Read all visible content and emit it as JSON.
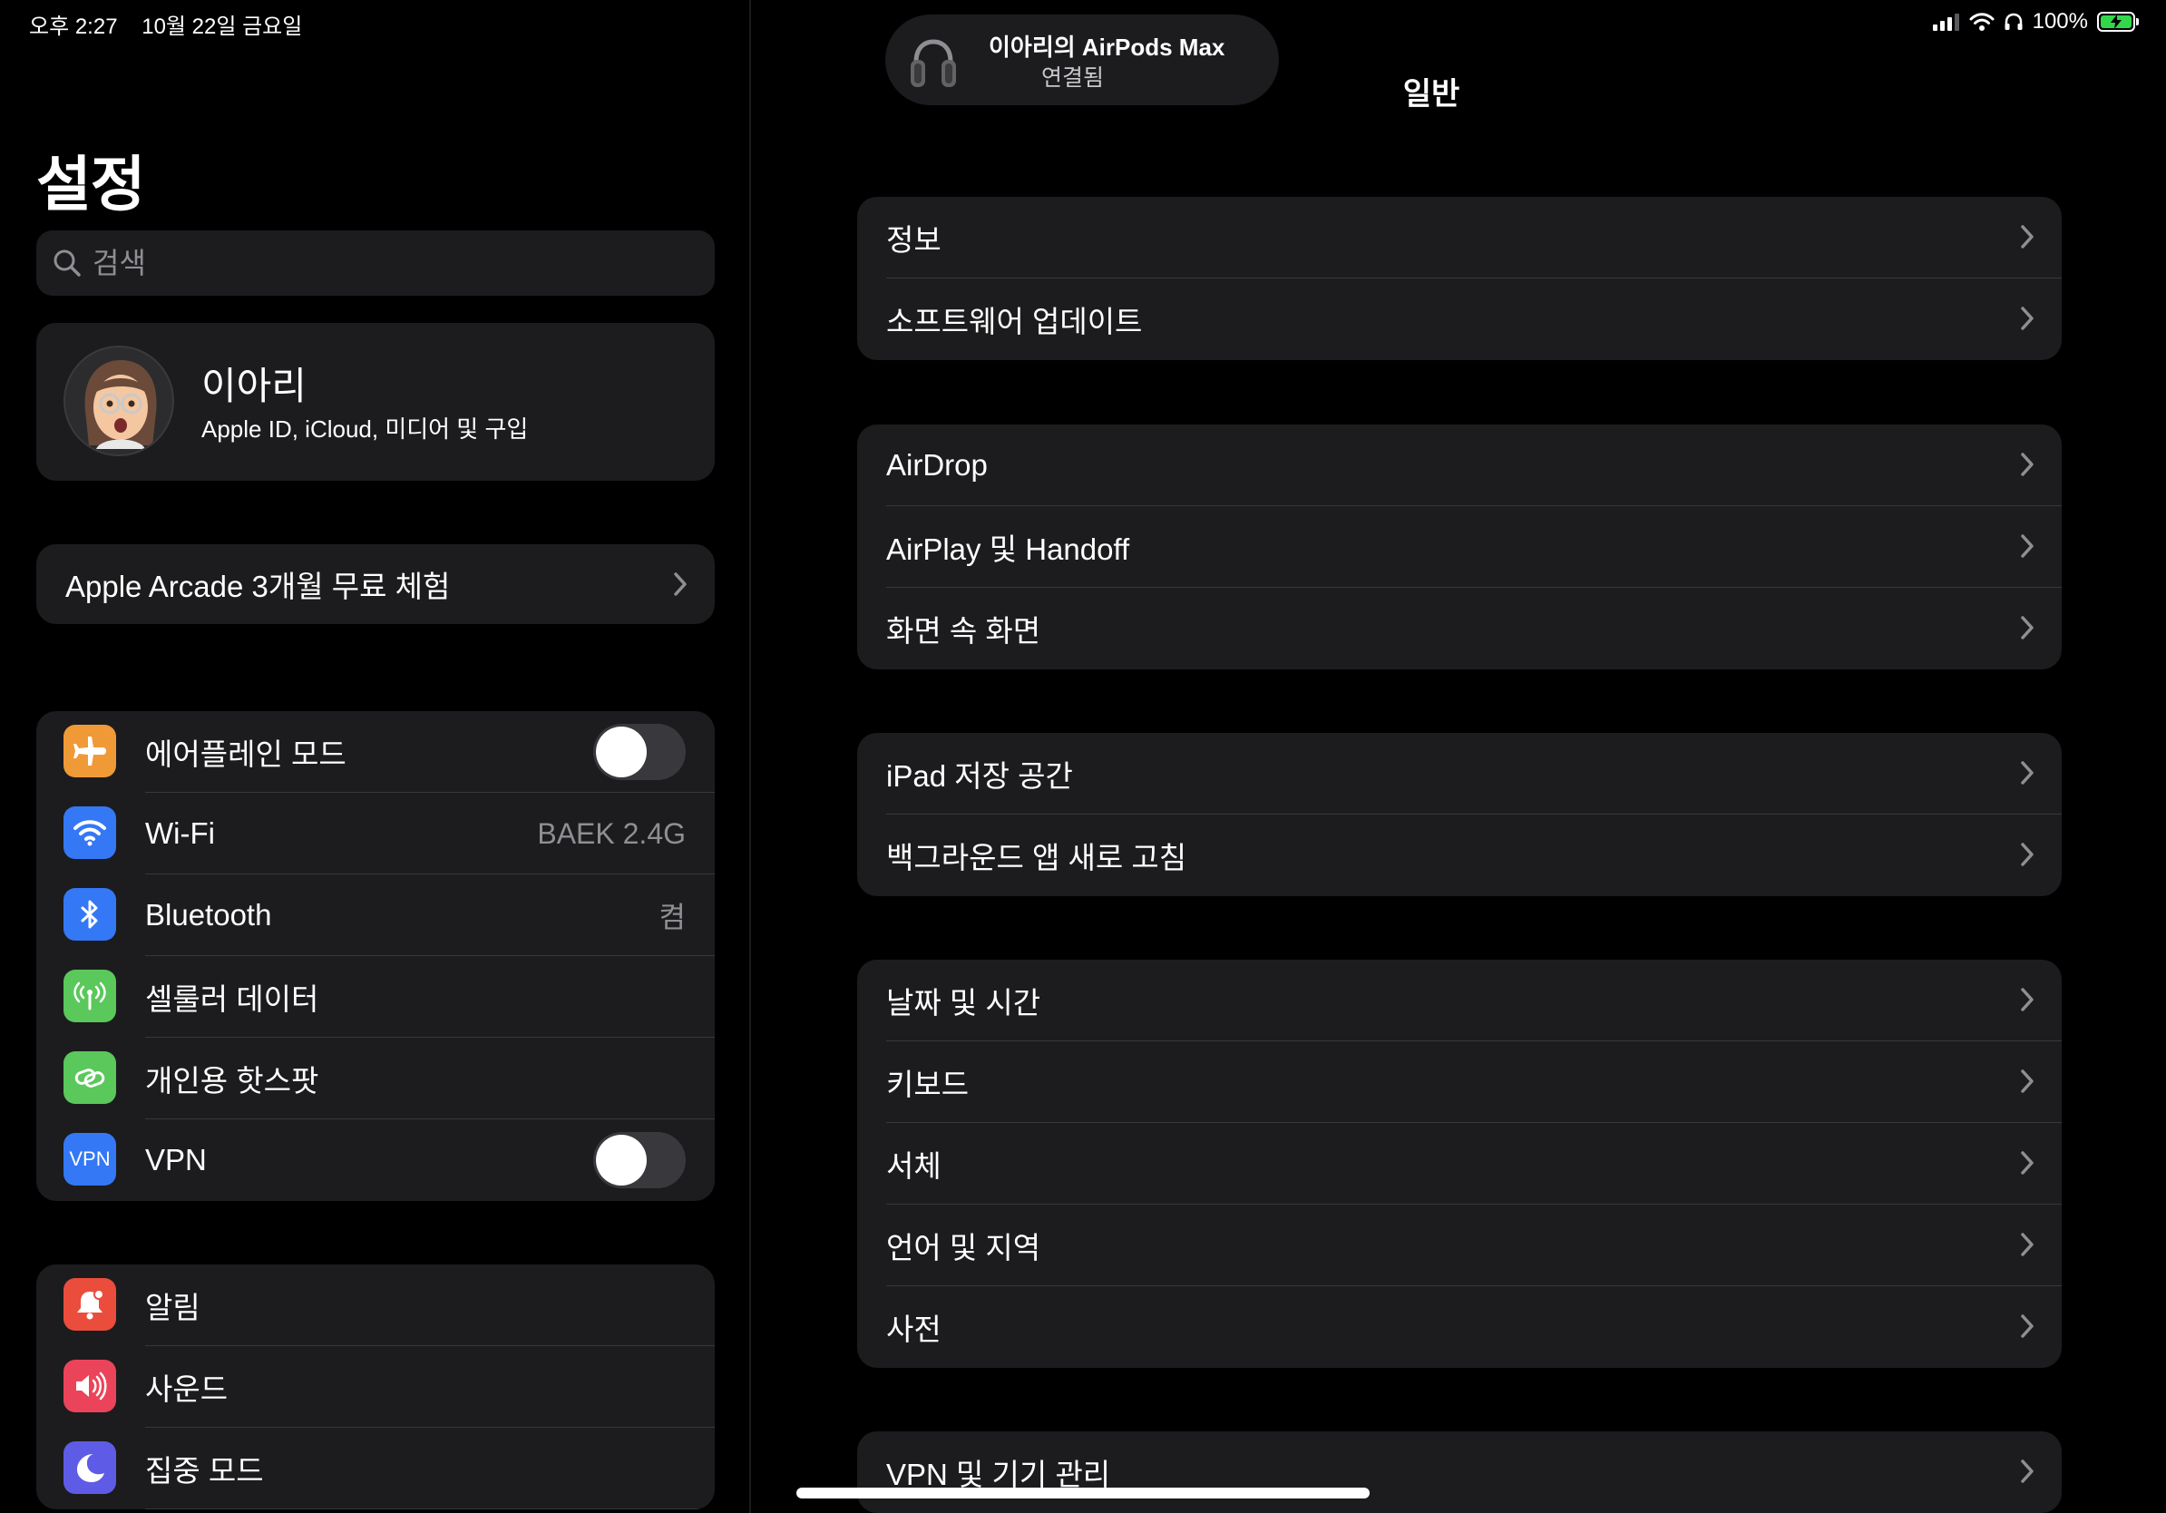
{
  "status_bar": {
    "time": "오후 2:27",
    "date": "10월 22일 금요일",
    "battery": "100%",
    "battery_color": "#32d74b"
  },
  "sidebar": {
    "title": "설정",
    "search_placeholder": "검색",
    "profile": {
      "name": "이아리",
      "subtitle": "Apple ID, iCloud, 미디어 및 구입"
    },
    "arcade_label": "Apple Arcade 3개월 무료 체험",
    "network_items": [
      {
        "label": "에어플레인 모드",
        "icon": "airplane-icon",
        "color": "#f09a37",
        "toggle": false
      },
      {
        "label": "Wi-Fi",
        "icon": "wifi-icon",
        "color": "#3478f6",
        "value": "BAEK 2.4G"
      },
      {
        "label": "Bluetooth",
        "icon": "bluetooth-icon",
        "color": "#3478f6",
        "value": "켬"
      },
      {
        "label": "셀룰러 데이터",
        "icon": "antenna-icon",
        "color": "#5ac85a"
      },
      {
        "label": "개인용 핫스팟",
        "icon": "hotspot-icon",
        "color": "#5ac85a"
      },
      {
        "label": "VPN",
        "icon": "vpn-icon",
        "icon_text": "VPN",
        "color": "#3478f6",
        "toggle": false
      }
    ],
    "notify_items": [
      {
        "label": "알림",
        "icon": "bell-icon",
        "color": "#eb4d3d"
      },
      {
        "label": "사운드",
        "icon": "speaker-icon",
        "color": "#eb445a"
      },
      {
        "label": "집중 모드",
        "icon": "moon-icon",
        "color": "#5e5ce6"
      }
    ]
  },
  "detail": {
    "title": "일반",
    "airpods_banner": {
      "title": "이아리의 AirPods Max",
      "status": "연결됨"
    },
    "groups": [
      [
        "정보",
        "소프트웨어 업데이트"
      ],
      [
        "AirDrop",
        "AirPlay 및 Handoff",
        "화면 속 화면"
      ],
      [
        "iPad 저장 공간",
        "백그라운드 앱 새로 고침"
      ],
      [
        "날짜 및 시간",
        "키보드",
        "서체",
        "언어 및 지역",
        "사전"
      ],
      [
        "VPN 및 기기 관리"
      ]
    ]
  }
}
